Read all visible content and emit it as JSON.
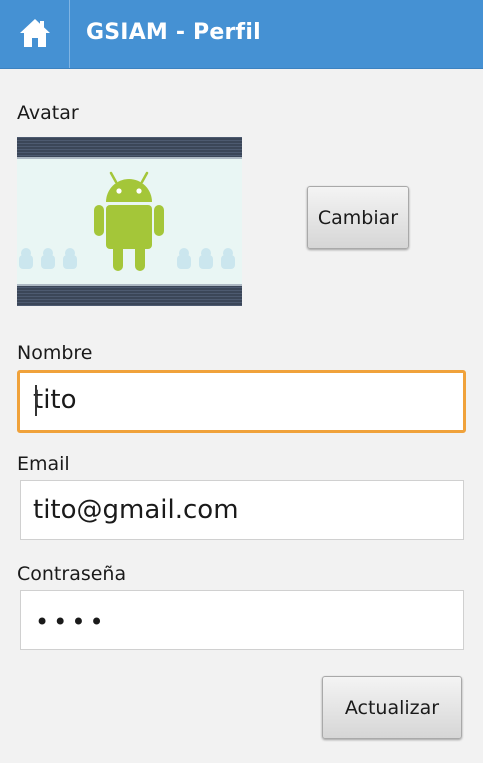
{
  "app_bar": {
    "title": "GSIAM - Perfil",
    "color": "#4591d3"
  },
  "avatar_section": {
    "label": "Avatar",
    "change_button": "Cambiar"
  },
  "form": {
    "name_label": "Nombre",
    "name_value": "tito",
    "email_label": "Email",
    "email_value": "tito@gmail.com",
    "password_label": "Contraseña",
    "password_masked": "••••"
  },
  "submit_button": "Actualizar",
  "focus_color": "#f0a23b"
}
